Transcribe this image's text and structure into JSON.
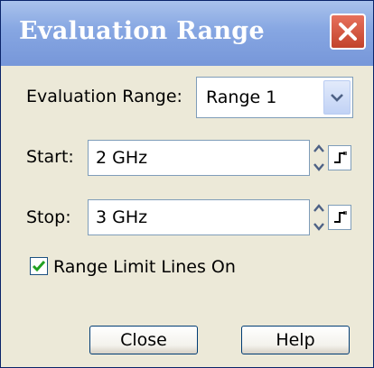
{
  "window": {
    "title": "Evaluation Range",
    "close_icon": "close-icon"
  },
  "range": {
    "label": "Evaluation Range:",
    "selected": "Range 1"
  },
  "start": {
    "label": "Start:",
    "value": "2 GHz"
  },
  "stop": {
    "label": "Stop:",
    "value": "3 GHz"
  },
  "limit_lines": {
    "label": "Range Limit Lines On",
    "checked": true
  },
  "buttons": {
    "close": "Close",
    "help": "Help"
  },
  "colors": {
    "titlebar": "#86a6e2",
    "dialog_bg": "#ece9d8",
    "close_button": "#c2432b",
    "check_mark": "#21a121"
  }
}
